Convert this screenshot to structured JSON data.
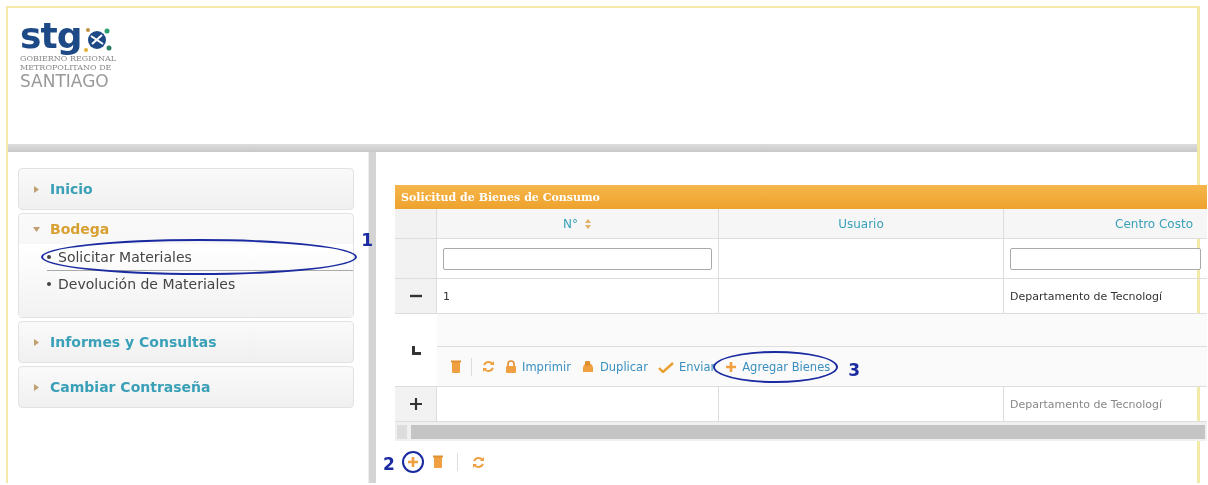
{
  "logo": {
    "wordmark": "stg",
    "lines": [
      "GOBIERNO REGIONAL",
      "METROPOLITANO DE"
    ],
    "city": "SANTIAGO"
  },
  "sidebar": {
    "items": [
      {
        "label": "Inicio",
        "expanded": false
      },
      {
        "label": "Bodega",
        "expanded": true,
        "children": [
          {
            "label": "Solicitar Materiales",
            "annotation": "1"
          },
          {
            "label": "Devolución de Materiales"
          }
        ]
      },
      {
        "label": "Informes y Consultas",
        "expanded": false
      },
      {
        "label": "Cambiar Contraseña",
        "expanded": false
      }
    ]
  },
  "table": {
    "title": "Solicitud de Bienes de Consumo",
    "columns": [
      {
        "label": "N°",
        "sortable": true,
        "filter": true
      },
      {
        "label": "Usuario",
        "sortable": false,
        "filter": false
      },
      {
        "label": "Centro Costo",
        "sortable": false,
        "filter": true
      }
    ],
    "rows": [
      {
        "expanded": true,
        "cells": [
          "1",
          "",
          "Departamento de Tecnologí"
        ],
        "dim": false,
        "actions": [
          {
            "kind": "delete"
          },
          {
            "kind": "refresh"
          },
          {
            "kind": "print",
            "label": "Imprimir"
          },
          {
            "kind": "duplicate",
            "label": "Duplicar"
          },
          {
            "kind": "send",
            "label": "Enviar"
          },
          {
            "kind": "add",
            "label": "Agregar Bienes",
            "annotation": "3"
          }
        ]
      },
      {
        "expanded": false,
        "cells": [
          "",
          "",
          "Departamento de Tecnologí"
        ],
        "dim": true
      }
    ],
    "footer_actions": [
      {
        "kind": "add",
        "annotation": "2"
      },
      {
        "kind": "delete"
      },
      {
        "kind": "refresh"
      }
    ]
  }
}
